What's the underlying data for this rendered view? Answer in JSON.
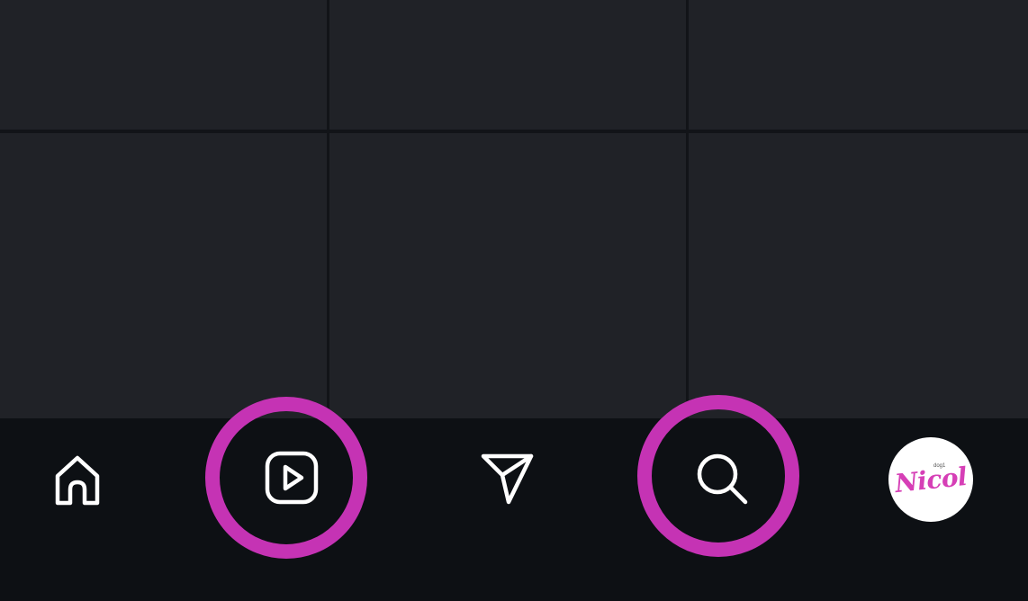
{
  "grid": {
    "tiles": [
      "",
      "",
      "",
      "",
      "",
      ""
    ]
  },
  "bottom_nav": {
    "items": [
      {
        "icon": "home-icon"
      },
      {
        "icon": "reels-icon",
        "highlighted": true
      },
      {
        "icon": "send-icon"
      },
      {
        "icon": "search-icon",
        "highlighted": true
      },
      {
        "icon": "profile-avatar"
      }
    ],
    "highlight_color": "#c533b4",
    "avatar_text": "Nicol",
    "avatar_small_text": "dog1"
  },
  "colors": {
    "background": "#0d1014",
    "tile": "#202227",
    "icon": "#ffffff",
    "accent": "#d63fb6"
  }
}
